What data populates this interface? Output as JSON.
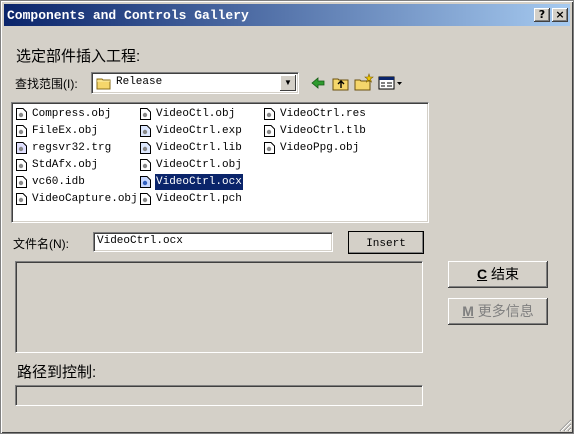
{
  "window": {
    "title": "Components and Controls Gallery",
    "help_button": "?",
    "close_button": "×"
  },
  "heading": "选定部件插入工程:",
  "lookin": {
    "label": "查找范围(I):",
    "value": "Release"
  },
  "files": [
    {
      "name": "Compress.obj",
      "icon": "obj-file-icon",
      "selected": false
    },
    {
      "name": "FileEx.obj",
      "icon": "obj-file-icon",
      "selected": false
    },
    {
      "name": "regsvr32.trg",
      "icon": "trg-file-icon",
      "selected": false
    },
    {
      "name": "StdAfx.obj",
      "icon": "obj-file-icon",
      "selected": false
    },
    {
      "name": "vc60.idb",
      "icon": "idb-file-icon",
      "selected": false
    },
    {
      "name": "VideoCapture.obj",
      "icon": "obj-file-icon",
      "selected": false
    },
    {
      "name": "VideoCtl.obj",
      "icon": "obj-file-icon",
      "selected": false
    },
    {
      "name": "VideoCtrl.exp",
      "icon": "exp-file-icon",
      "selected": false
    },
    {
      "name": "VideoCtrl.lib",
      "icon": "lib-file-icon",
      "selected": false
    },
    {
      "name": "VideoCtrl.obj",
      "icon": "obj-file-icon",
      "selected": false
    },
    {
      "name": "VideoCtrl.ocx",
      "icon": "ocx-file-icon",
      "selected": true
    },
    {
      "name": "VideoCtrl.pch",
      "icon": "pch-file-icon",
      "selected": false
    },
    {
      "name": "VideoCtrl.res",
      "icon": "res-file-icon",
      "selected": false
    },
    {
      "name": "VideoCtrl.tlb",
      "icon": "tlb-file-icon",
      "selected": false
    },
    {
      "name": "VideoPpg.obj",
      "icon": "obj-file-icon",
      "selected": false
    }
  ],
  "filename": {
    "label": "文件名(N):",
    "value": "VideoCtrl.ocx"
  },
  "buttons": {
    "insert": "Insert",
    "close_key": "C",
    "close_text": "结束",
    "more_key": "M",
    "more_text": "更多信息"
  },
  "path_label": "路径到控制:"
}
